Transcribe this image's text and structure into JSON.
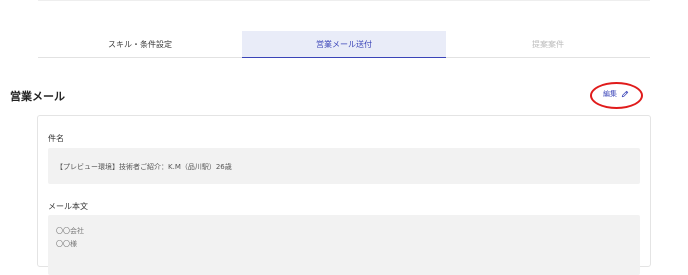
{
  "tabs": [
    {
      "label": "スキル・条件設定",
      "state": "normal"
    },
    {
      "label": "営業メール送付",
      "state": "active"
    },
    {
      "label": "提案案件",
      "state": "disabled"
    }
  ],
  "section": {
    "title": "営業メール",
    "edit_label": "編集",
    "edit_icon": "pencil-icon"
  },
  "form": {
    "subject_label": "件名",
    "subject_value": "【プレビュー環境】技術者ご紹介：K.M（品川駅）26歳",
    "body_label": "メール本文",
    "body_lines": [
      "〇〇会社",
      "〇〇様"
    ]
  },
  "colors": {
    "accent": "#3a44b8",
    "active_tab_bg": "#e9ecf8",
    "highlight_circle": "#e01b1b"
  }
}
